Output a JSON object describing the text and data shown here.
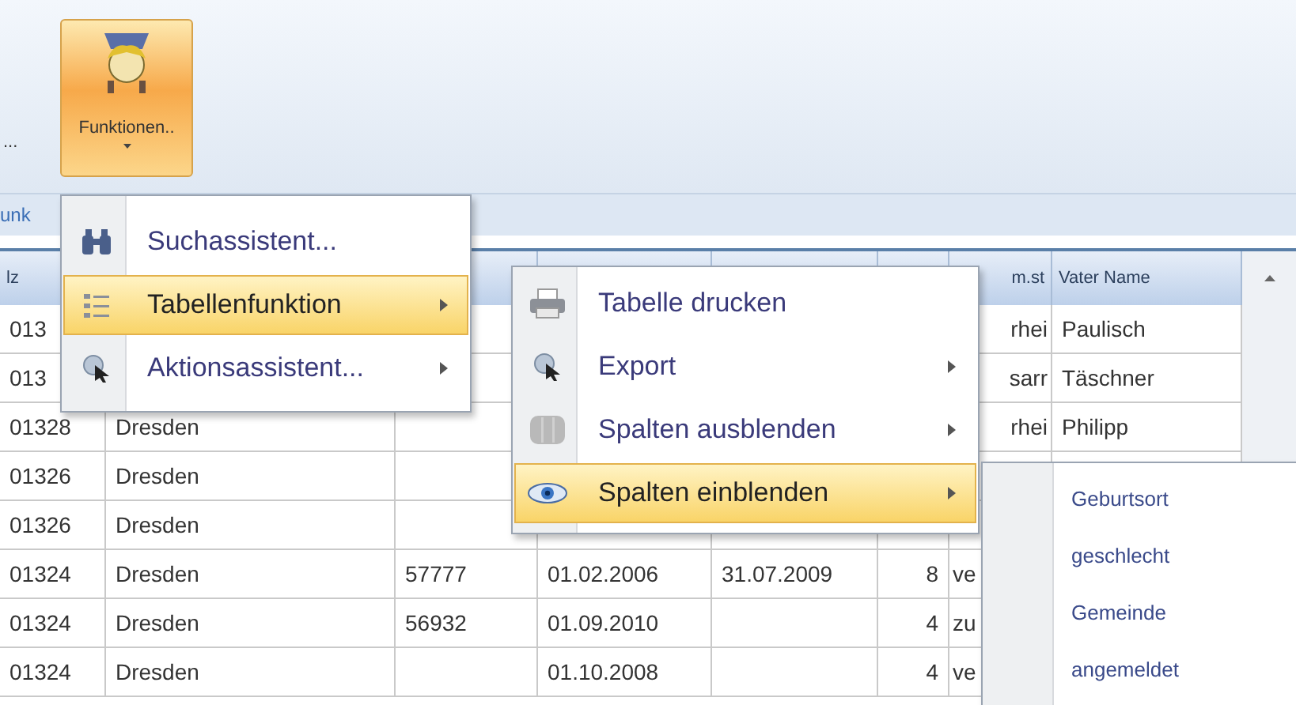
{
  "ribbon": {
    "partial_label": "...",
    "button": {
      "label": "Funktionen..",
      "selected": true
    },
    "group_label": "unk"
  },
  "table": {
    "columns": [
      "lz",
      null,
      null,
      null,
      null,
      null,
      "m.st",
      "Vater Name"
    ],
    "rows": [
      {
        "cells": [
          "013",
          null,
          null,
          null,
          null,
          null,
          "rhei",
          "Paulisch"
        ]
      },
      {
        "cells": [
          "013",
          null,
          null,
          null,
          null,
          null,
          "sarr",
          "Täschner"
        ]
      },
      {
        "cells": [
          "01328",
          "Dresden",
          null,
          null,
          null,
          null,
          "rhei",
          "Philipp"
        ]
      },
      {
        "cells": [
          "01326",
          "Dresden",
          null,
          null,
          null,
          null,
          null,
          null
        ]
      },
      {
        "cells": [
          "01326",
          "Dresden",
          null,
          null,
          null,
          null,
          null,
          null
        ]
      },
      {
        "cells": [
          "01324",
          "Dresden",
          "57777",
          "01.02.2006",
          "31.07.2009",
          "8",
          "ve",
          null
        ]
      },
      {
        "cells": [
          "01324",
          "Dresden",
          "56932",
          "01.09.2010",
          null,
          "4",
          "zu",
          null
        ]
      },
      {
        "cells": [
          "01324",
          "Dresden",
          null,
          "01.10.2008",
          null,
          "4",
          "ve",
          null
        ]
      }
    ]
  },
  "menu": {
    "items": [
      {
        "label": "Suchassistent...",
        "has_submenu": false,
        "selected": false
      },
      {
        "label": "Tabellenfunktion",
        "has_submenu": true,
        "selected": true
      },
      {
        "label": "Aktionsassistent...",
        "has_submenu": true,
        "selected": false
      }
    ]
  },
  "submenu": {
    "items": [
      {
        "label": "Tabelle drucken",
        "has_submenu": false,
        "selected": false
      },
      {
        "label": "Export",
        "has_submenu": true,
        "selected": false
      },
      {
        "label": "Spalten ausblenden",
        "has_submenu": true,
        "selected": false
      },
      {
        "label": "Spalten einblenden",
        "has_submenu": true,
        "selected": true
      }
    ]
  },
  "column_menu": {
    "items": [
      {
        "label": "Geburtsort"
      },
      {
        "label": "geschlecht"
      },
      {
        "label": "Gemeinde"
      },
      {
        "label": "angemeldet"
      }
    ]
  }
}
